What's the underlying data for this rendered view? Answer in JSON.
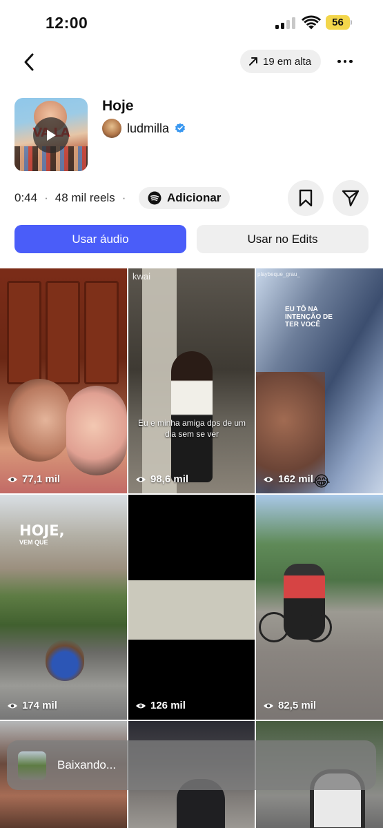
{
  "status_bar": {
    "time": "12:00",
    "battery": "56",
    "battery_color": "#f3d64b"
  },
  "header": {
    "trend_label": "19 em alta"
  },
  "audio": {
    "title": "Hoje",
    "cover_text": "VA LA",
    "artist": "ludmilla",
    "duration": "0:44",
    "reels_count": "48 mil reels",
    "add_label": "Adicionar"
  },
  "actions": {
    "use_audio": "Usar áudio",
    "use_edits": "Usar no Edits",
    "primary_color": "#4a5df9"
  },
  "grid": {
    "items": [
      {
        "views": "77,1 mil"
      },
      {
        "views": "98,6 mil",
        "logo": "kwai",
        "caption": "Eu e minha amiga dps de um dia sem se ver"
      },
      {
        "views": "162 mil",
        "handle": "playbeque_grau_",
        "overlay": "EU TÔ NA INTENÇÃO DE TER VOCÊ"
      },
      {
        "views": "174 mil",
        "overlay_big": "HOJE,",
        "overlay_small": "VEM QUE"
      },
      {
        "views": "126 mil"
      },
      {
        "views": "82,5 mil"
      }
    ]
  },
  "toast": {
    "text": "Baixando..."
  }
}
